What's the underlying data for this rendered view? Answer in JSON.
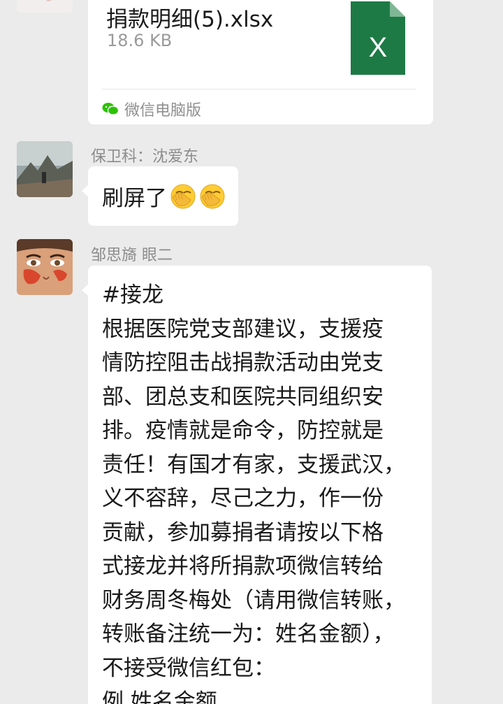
{
  "messages": [
    {
      "type": "file",
      "file_name": "捐款明细(5).xlsx",
      "file_size": "18.6 KB",
      "file_icon": "excel-file-icon",
      "file_icon_letter": "X",
      "source_icon": "wechat-icon",
      "source": "微信电脑版"
    },
    {
      "type": "text",
      "sender": "保卫科：沈爱东",
      "text": "刷屏了",
      "emojis": [
        "facepalm-emoji",
        "facepalm-emoji"
      ]
    },
    {
      "type": "text",
      "sender": "邹思旖 眼二",
      "lines": [
        "#接龙",
        "根据医院党支部建议，支援疫",
        "情防控阻击战捐款活动由党支",
        "部、团总支和医院共同组织安",
        "排。疫情就是命令，防控就是",
        "责任！有国才有家，支援武汉，",
        "义不容辞，尽己之力，作一份",
        "贡献，参加募捐者请按以下格",
        "式接龙并将所捐款项微信转给",
        "财务周冬梅处（请用微信转账，",
        "转账备注统一为：姓名金额），",
        "不接受微信红包：",
        "例 姓名金额"
      ]
    }
  ],
  "colors": {
    "background": "#ebebeb",
    "bubble": "#ffffff",
    "excel_green": "#1d7a45",
    "wechat_green": "#2dc100",
    "meta_text": "#8c8c8c"
  }
}
